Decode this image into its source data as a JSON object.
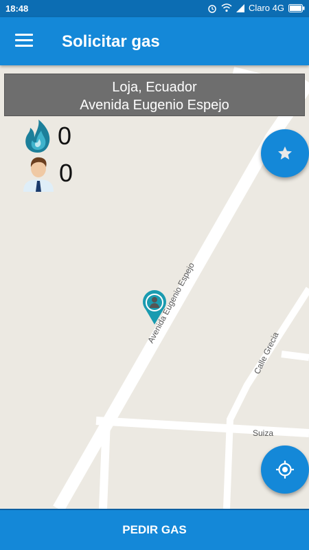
{
  "status_bar": {
    "time": "18:48",
    "carrier": "Claro 4G",
    "icons": [
      "alarm-icon",
      "wifi-icon",
      "signal-icon",
      "battery-icon"
    ]
  },
  "app_bar": {
    "title": "Solicitar gas",
    "menu_icon": "hamburger-menu-icon"
  },
  "address": {
    "line1": "Loja, Ecuador",
    "line2": "Avenida Eugenio Espejo"
  },
  "stats": {
    "gas_count": "0",
    "person_count": "0"
  },
  "map": {
    "streets": {
      "main": "Avenida Eugenio Espejo",
      "grecia": "Calle Grecia",
      "suiza": "Suiza"
    }
  },
  "fabs": {
    "favorite_icon": "star-icon",
    "locate_icon": "my-location-icon"
  },
  "bottom_button": {
    "label": "PEDIR GAS"
  },
  "colors": {
    "primary": "#1488d8",
    "status_bar": "#0c6db3",
    "marker": "#1a9bb0"
  }
}
